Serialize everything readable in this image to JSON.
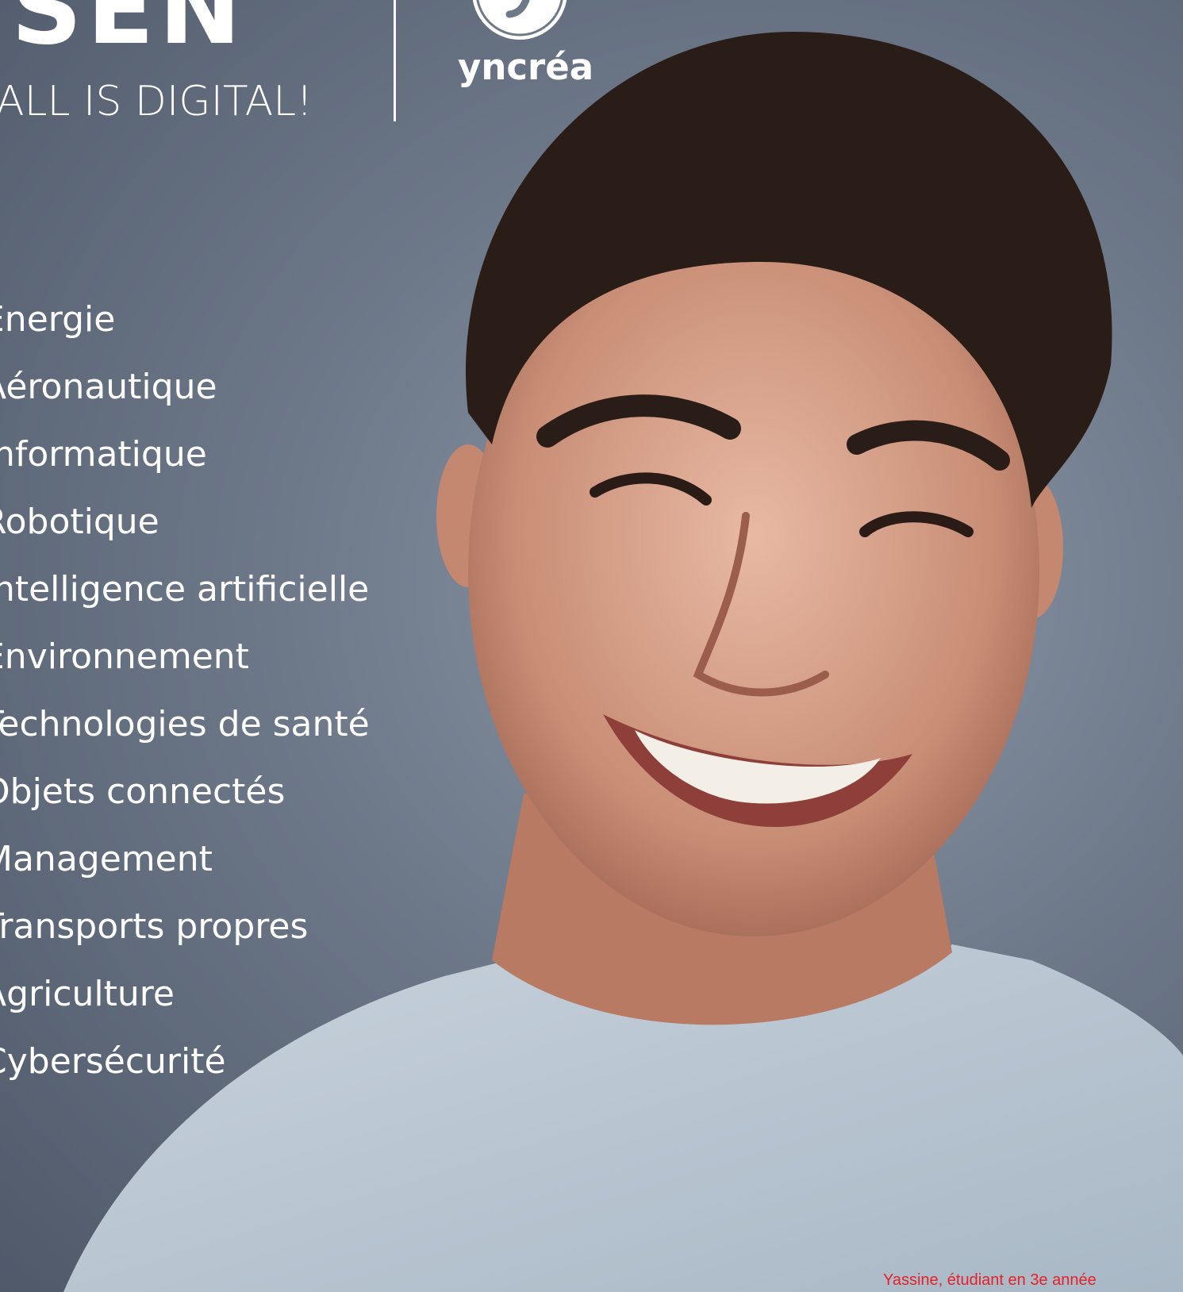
{
  "brand": {
    "title": "ISEN",
    "tagline": "ALL IS DIGITAL!",
    "logo_text": "yncréa"
  },
  "domains": [
    "Énergie",
    "Aéronautique",
    "Informatique",
    "Robotique",
    "Intelligence artificielle",
    "Environnement",
    "Technologies de santé",
    "Objets connectés",
    "Management",
    "Transports propres",
    "Agriculture",
    "Cybersécurité"
  ],
  "caption": "Yassine, étudiant en 3e année",
  "colors": {
    "background": "#6d7889",
    "text": "#ffffff",
    "caption": "#e52228"
  },
  "icons": {
    "logo": "yncrea-logo-icon"
  }
}
